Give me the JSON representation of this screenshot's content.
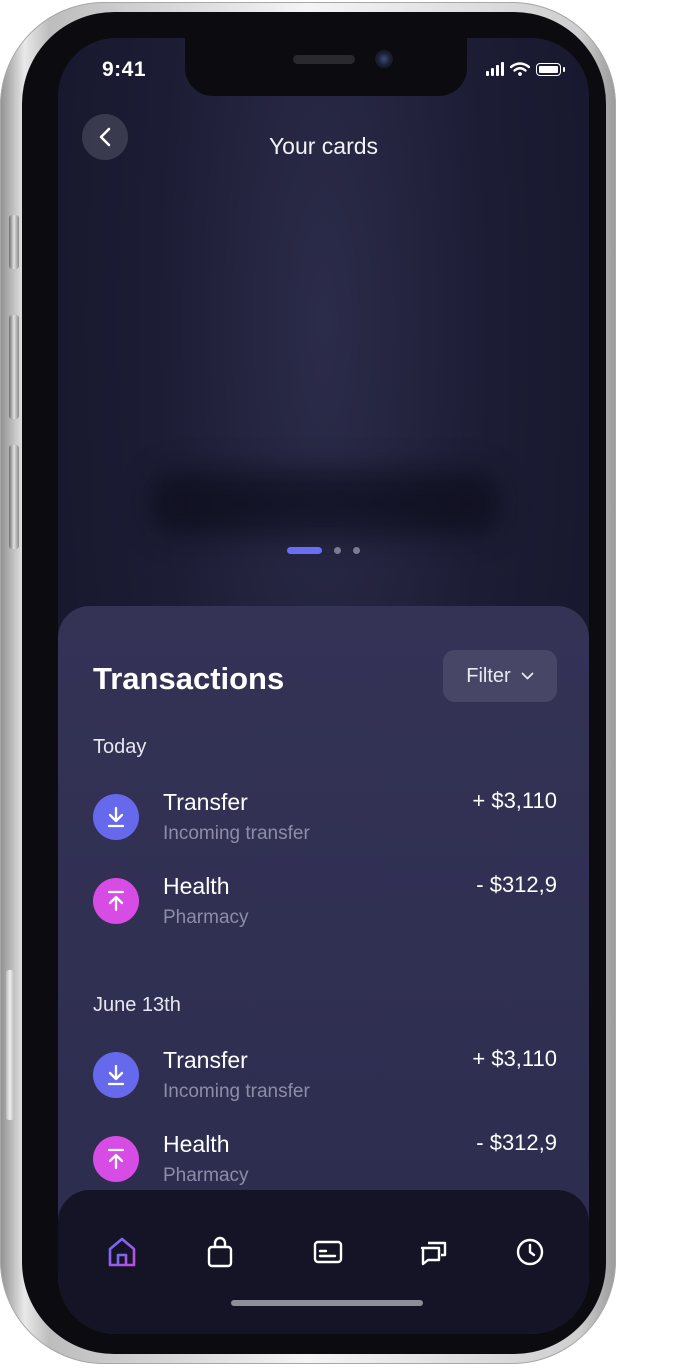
{
  "status_bar": {
    "time": "9:41"
  },
  "header": {
    "title": "Your cards",
    "back_icon": "chevron-left-icon"
  },
  "carousel": {
    "page_count": 3,
    "active_index": 0
  },
  "transactions": {
    "title": "Transactions",
    "filter_label": "Filter",
    "groups": [
      {
        "label": "Today",
        "items": [
          {
            "title": "Transfer",
            "subtitle": "Incoming transfer",
            "amount": "+ $3,110",
            "direction": "incoming",
            "icon": "arrow-down-icon",
            "color": "#6769ec"
          },
          {
            "title": "Health",
            "subtitle": "Pharmacy",
            "amount": "- $312,9",
            "direction": "outgoing",
            "icon": "arrow-up-icon",
            "color": "#d84ce6"
          }
        ]
      },
      {
        "label": "June 13th",
        "items": [
          {
            "title": "Transfer",
            "subtitle": "Incoming transfer",
            "amount": "+ $3,110",
            "direction": "incoming",
            "icon": "arrow-down-icon",
            "color": "#6769ec"
          },
          {
            "title": "Health",
            "subtitle": "Pharmacy",
            "amount": "- $312,9",
            "direction": "outgoing",
            "icon": "arrow-up-icon",
            "color": "#d84ce6"
          }
        ]
      }
    ]
  },
  "tab_bar": {
    "active": "home",
    "tabs": [
      "home-icon",
      "shopping-bag-icon",
      "card-icon",
      "chat-icon",
      "clock-icon"
    ]
  },
  "colors": {
    "accent": "#6a6ef2",
    "incoming": "#6769ec",
    "outgoing": "#d84ce6",
    "background": "#1c1c34",
    "sheet": "#343356"
  }
}
